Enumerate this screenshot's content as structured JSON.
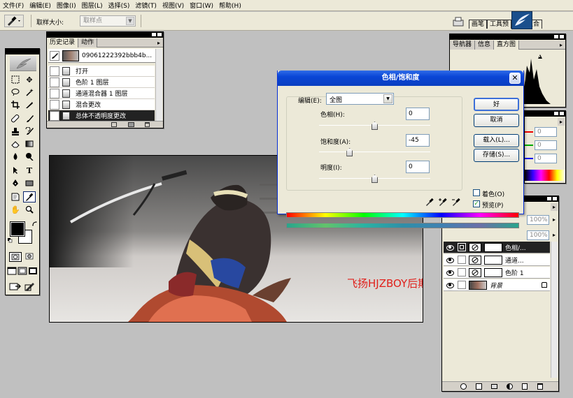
{
  "menubar": {
    "items": [
      "文件(F)",
      "编辑(E)",
      "图像(I)",
      "图层(L)",
      "选择(S)",
      "滤镜(T)",
      "视图(V)",
      "窗口(W)",
      "帮助(H)"
    ]
  },
  "options_bar": {
    "sample_size_label": "取样大小:",
    "sample_size_value": "取样点",
    "palette_well_tabs": [
      "画笔",
      "工具预",
      "图层复合"
    ]
  },
  "history_panel": {
    "tabs": [
      "历史记录",
      "动作"
    ],
    "snapshot_name": "09061222392bbb4b...",
    "steps": [
      "打开",
      "色阶 1 图层",
      "通道混合器 1 图层",
      "混合更改",
      "总体不透明度更改"
    ]
  },
  "navigator_panel": {
    "tabs": [
      "导航器",
      "信息",
      "直方图"
    ]
  },
  "color_panel": {
    "fields": [
      "0",
      "0",
      "0"
    ]
  },
  "layers_panel": {
    "zoom_fields": [
      "100%",
      "100%"
    ],
    "layers": [
      "色相/...",
      "通道...",
      "色阶 1",
      "背景"
    ]
  },
  "canvas": {
    "watermark": "飞扬HJZBOY后期调色步骤"
  },
  "dialog": {
    "title": "色相/饱和度",
    "edit_label": "编辑(E):",
    "edit_value": "全图",
    "hue_label": "色相(H):",
    "hue_value": "0",
    "hue_level": 0.5,
    "saturation_label": "饱和度(A):",
    "saturation_value": "-45",
    "saturation_level": 0.275,
    "lightness_label": "明度(I):",
    "lightness_value": "0",
    "lightness_level": 0.5,
    "ok_button": "好",
    "cancel_button": "取消",
    "load_button": "载入(L)...",
    "save_button": "存储(S)...",
    "colorize_label": "着色(O)",
    "colorize_checked": false,
    "preview_label": "预览(P)",
    "preview_checked": true
  },
  "colors": {
    "dialog_title": "#1c4fc4",
    "ok_border": "#3c6fd8",
    "watermark": "#e0201b",
    "highlight_row": "#222222"
  }
}
